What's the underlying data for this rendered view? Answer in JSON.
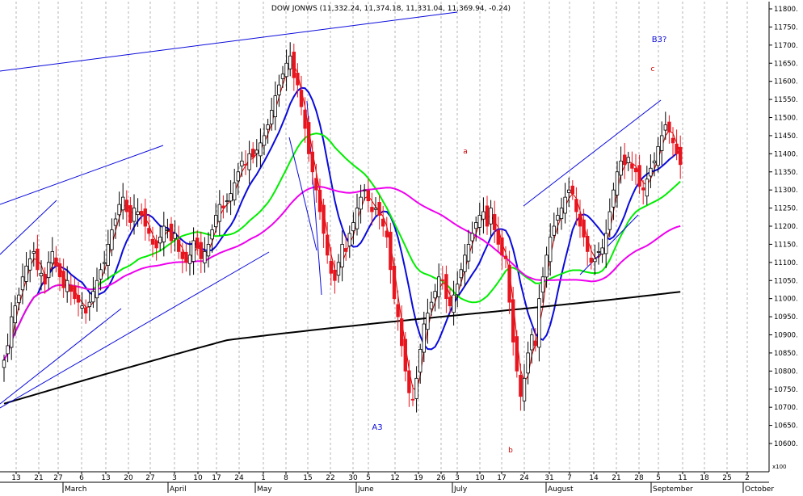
{
  "chart_data": {
    "type": "candlestick",
    "title": "DOW JONWS (11,332.24, 11,374.18, 11,331.04, 11,369.94, -0.24)",
    "ylim": [
      10580,
      11830
    ],
    "yticks": [
      10600,
      10650,
      10700,
      10750,
      10800,
      10850,
      10900,
      10950,
      11000,
      11050,
      11100,
      11150,
      11200,
      11250,
      11300,
      11350,
      11400,
      11450,
      11500,
      11550,
      11600,
      11650,
      11700,
      11750,
      11800
    ],
    "ytick_labels": [
      "10600.",
      "10650.",
      "10700.",
      "10750.",
      "10800.",
      "10850.",
      "10900.",
      "10950.",
      "11000.",
      "11050.",
      "11100.",
      "11150.",
      "11200.",
      "11250.",
      "11300.",
      "11350.",
      "11400.",
      "11450.",
      "11500.",
      "11550.",
      "11600.",
      "11650.",
      "11700.",
      "11750.",
      "11800."
    ],
    "scale_label": "x100",
    "grid": true,
    "x_day_labels": [
      "13",
      "21",
      "27",
      "6",
      "13",
      "20",
      "27",
      "3",
      "10",
      "17",
      "24",
      "1",
      "8",
      "15",
      "22",
      "30",
      "5",
      "12",
      "19",
      "26",
      "3",
      "10",
      "17",
      "24",
      "31",
      "7",
      "14",
      "21",
      "28",
      "5",
      "11",
      "18",
      "25",
      "2"
    ],
    "x_month_labels": [
      "March",
      "April",
      "May",
      "June",
      "July",
      "August",
      "September",
      "October"
    ],
    "annotations": [
      "a",
      "b",
      "c",
      "A3",
      "B3?"
    ],
    "closes": [
      10830,
      10870,
      10950,
      10980,
      11010,
      11060,
      11090,
      11110,
      11130,
      11080,
      11070,
      11040,
      11100,
      11130,
      11090,
      11060,
      11030,
      11050,
      11020,
      11000,
      10990,
      10980,
      10960,
      10990,
      11020,
      11050,
      11080,
      11100,
      11150,
      11190,
      11220,
      11260,
      11280,
      11240,
      11210,
      11250,
      11240,
      11230,
      11200,
      11180,
      11150,
      11140,
      11170,
      11200,
      11190,
      11160,
      11180,
      11130,
      11110,
      11100,
      11120,
      11160,
      11140,
      11110,
      11130,
      11150,
      11190,
      11230,
      11260,
      11250,
      11270,
      11290,
      11320,
      11350,
      11380,
      11370,
      11400,
      11390,
      11410,
      11430,
      11450,
      11480,
      11520,
      11560,
      11590,
      11620,
      11650,
      11670,
      11610,
      11590,
      11530,
      11470,
      11400,
      11350,
      11300,
      11240,
      11180,
      11120,
      11070,
      11050,
      11100,
      11150,
      11130,
      11180,
      11210,
      11250,
      11280,
      11300,
      11270,
      11240,
      11250,
      11230,
      11200,
      11170,
      11080,
      11000,
      10950,
      10870,
      10800,
      10740,
      10720,
      10780,
      10860,
      10930,
      10960,
      10990,
      11020,
      11060,
      11050,
      11000,
      10980,
      11010,
      11040,
      11080,
      11120,
      11150,
      11180,
      11210,
      11230,
      11240,
      11200,
      11250,
      11190,
      11150,
      11120,
      11110,
      10990,
      10880,
      10800,
      10730,
      10780,
      10850,
      10900,
      10870,
      11000,
      11060,
      11120,
      11170,
      11200,
      11230,
      11250,
      11280,
      11300,
      11290,
      11240,
      11200,
      11170,
      11130,
      11100,
      11110,
      11130,
      11140,
      11180,
      11240,
      11300,
      11350,
      11380,
      11370,
      11390,
      11360,
      11350,
      11310,
      11300,
      11330,
      11360,
      11380,
      11420,
      11450,
      11480,
      11460,
      11430,
      11400,
      11370
    ],
    "series": [
      {
        "name": "daily price",
        "color": "#e8141e",
        "style": "candles"
      },
      {
        "name": "fast MA",
        "color": "#cc0000",
        "data": "ma5"
      },
      {
        "name": "MA 20",
        "color": "#0a0adc",
        "data": "ma20"
      },
      {
        "name": "MA 50",
        "color": "#00ee00",
        "data": "ma50"
      },
      {
        "name": "MA 100",
        "color": "#ee00ee",
        "data": "ma100"
      },
      {
        "name": "MA 200",
        "color": "#000000",
        "data": "ma200"
      }
    ]
  },
  "colors": {
    "bear": "#e8141e",
    "bull": "#ffffff",
    "grid": "#b4b4b4",
    "trendline": "#0a0adc"
  }
}
